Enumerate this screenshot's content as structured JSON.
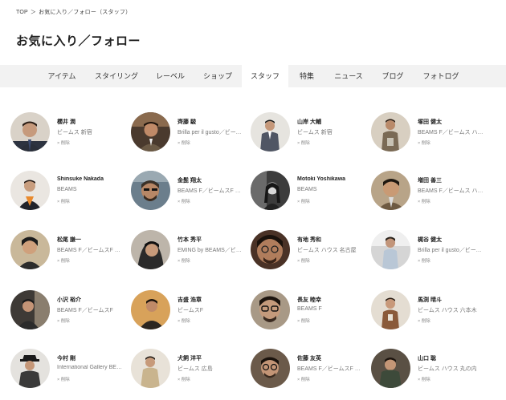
{
  "breadcrumb": [
    "TOP",
    "＞",
    "お気に入り／フォロー（スタッフ）"
  ],
  "page_title": "お気に入り／フォロー",
  "tabs": [
    {
      "label": "アイテム"
    },
    {
      "label": "スタイリング"
    },
    {
      "label": "レーベル"
    },
    {
      "label": "ショップ"
    },
    {
      "label": "スタッフ",
      "active": true
    },
    {
      "label": "特集"
    },
    {
      "label": "ニュース"
    },
    {
      "label": "ブログ"
    },
    {
      "label": "フォトログ"
    }
  ],
  "colors": {
    "tab_bar": "#f2f2f2",
    "active_tab": "#ffffff",
    "text": "#222222",
    "muted": "#777777"
  },
  "staff": [
    {
      "name": "櫻井 潤",
      "shop": "ビームス 新宿",
      "action": "× 削除"
    },
    {
      "name": "齊藤 駿",
      "shop": "Brilla per il gusto／ビーム…",
      "action": "× 削除"
    },
    {
      "name": "山岸 大輔",
      "shop": "ビームス 新宿",
      "action": "× 削除"
    },
    {
      "name": "塚田 健太",
      "shop": "BEAMS F／ビームス ハウ…",
      "action": "× 削除"
    },
    {
      "name": "Shinsuke Nakada",
      "shop": "BEAMS",
      "action": "× 削除"
    },
    {
      "name": "金髭 翔太",
      "shop": "BEAMS F／ビームスF 新宿",
      "action": "× 削除"
    },
    {
      "name": "Motoki Yoshikawa",
      "shop": "BEAMS",
      "action": "× 削除"
    },
    {
      "name": "増田 善三",
      "shop": "BEAMS F／ビームス ハウ…",
      "action": "× 削除"
    },
    {
      "name": "松尾 謙一",
      "shop": "BEAMS F／ビームスF 新…",
      "action": "× 削除"
    },
    {
      "name": "竹本 秀平",
      "shop": "EMING by BEAMS／ビー…",
      "action": "× 削除"
    },
    {
      "name": "有地 秀和",
      "shop": "ビームス ハウス 名古屋",
      "action": "× 削除"
    },
    {
      "name": "梶谷 健太",
      "shop": "Brilla per il gusto／ビーム…",
      "action": "× 削除"
    },
    {
      "name": "小沢 裕介",
      "shop": "BEAMS F／ビームスF",
      "action": "× 削除"
    },
    {
      "name": "吉盛 浩章",
      "shop": "ビームスF",
      "action": "× 削除"
    },
    {
      "name": "長友 睦幸",
      "shop": "BEAMS F",
      "action": "× 削除"
    },
    {
      "name": "馬渕 晴斗",
      "shop": "ビームス ハウス 六本木",
      "action": "× 削除"
    },
    {
      "name": "今村 剛",
      "shop": "International Gallery BEA…",
      "action": "× 削除"
    },
    {
      "name": "犬飼 洋平",
      "shop": "ビームス 広島",
      "action": "× 削除"
    },
    {
      "name": "佐藤 友英",
      "shop": "BEAMS F／ビームスF 立川",
      "action": "× 削除"
    },
    {
      "name": "山口 聡",
      "shop": "ビームス ハウス 丸の内",
      "action": "× 削除"
    }
  ]
}
